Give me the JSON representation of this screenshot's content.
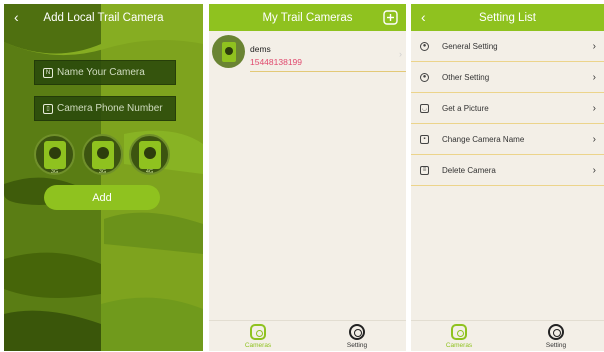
{
  "screen1": {
    "title": "Add Local Trail Camera",
    "back": "‹",
    "name_placeholder": "Name Your Camera",
    "phone_placeholder": "Camera Phone Number",
    "camera_types": [
      "3G",
      "3G",
      "4G"
    ],
    "add_label": "Add"
  },
  "screen2": {
    "title": "My Trail Cameras",
    "cameras": [
      {
        "name": "dems",
        "phone": "15448138199"
      }
    ],
    "tabs": {
      "cameras": "Cameras",
      "setting": "Setting"
    }
  },
  "screen3": {
    "title": "Setting List",
    "back": "‹",
    "items": [
      {
        "label": "General Setting",
        "icon": "gear-icon"
      },
      {
        "label": "Other Setting",
        "icon": "gear-icon"
      },
      {
        "label": "Get a Picture",
        "icon": "picture-icon"
      },
      {
        "label": "Change Camera Name",
        "icon": "camera-icon"
      },
      {
        "label": "Delete Camera",
        "icon": "trash-icon"
      }
    ],
    "tabs": {
      "cameras": "Cameras",
      "setting": "Setting"
    }
  },
  "colors": {
    "accent": "#8fc21f",
    "phone": "#e04a6e",
    "divider": "#ecd48b"
  }
}
